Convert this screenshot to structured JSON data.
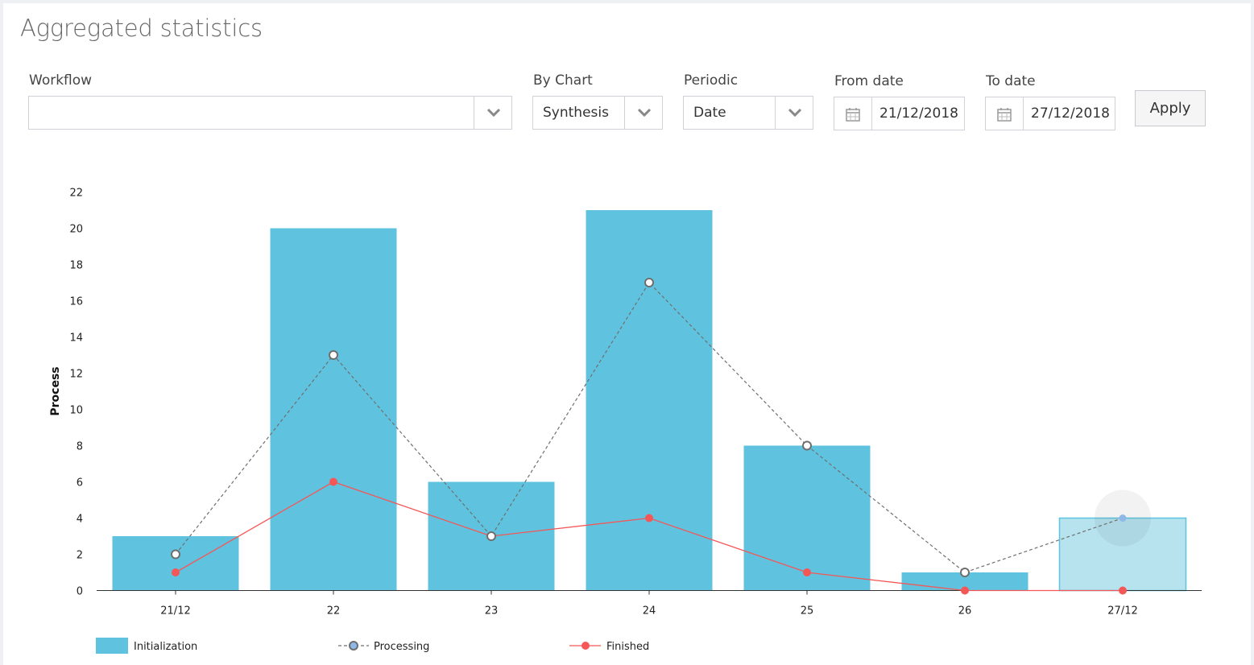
{
  "page": {
    "title": "Aggregated statistics"
  },
  "filters": {
    "workflow": {
      "label": "Workflow",
      "value": ""
    },
    "by_chart": {
      "label": "By Chart",
      "value": "Synthesis"
    },
    "periodic": {
      "label": "Periodic",
      "value": "Date"
    },
    "from_date": {
      "label": "From date",
      "value": "21/12/2018"
    },
    "to_date": {
      "label": "To date",
      "value": "27/12/2018"
    },
    "apply_label": "Apply"
  },
  "colors": {
    "bar": "#5fc3df",
    "bar_highlight": "#b7e3ef",
    "processing": "#6f6f6f",
    "finished": "#f55656",
    "hover_point": "#8fb7e8"
  },
  "chart_data": {
    "type": "bar",
    "categories": [
      "21/12",
      "22",
      "23",
      "24",
      "25",
      "26",
      "27/12"
    ],
    "ylabel": "Process",
    "xlabel": "",
    "ylim": [
      0,
      22
    ],
    "yticks": [
      0,
      2,
      4,
      6,
      8,
      10,
      12,
      14,
      16,
      18,
      20,
      22
    ],
    "grid": false,
    "legend_position": "bottom-left",
    "series": [
      {
        "name": "Initialization",
        "type": "bar",
        "values": [
          3,
          20,
          6,
          21,
          8,
          1,
          4
        ]
      },
      {
        "name": "Processing",
        "type": "line",
        "style": "dashed",
        "values": [
          2,
          13,
          3,
          17,
          8,
          1,
          4
        ]
      },
      {
        "name": "Finished",
        "type": "line",
        "style": "solid",
        "values": [
          1,
          6,
          3,
          4,
          1,
          0,
          0
        ]
      }
    ],
    "highlighted_category": "27/12"
  }
}
